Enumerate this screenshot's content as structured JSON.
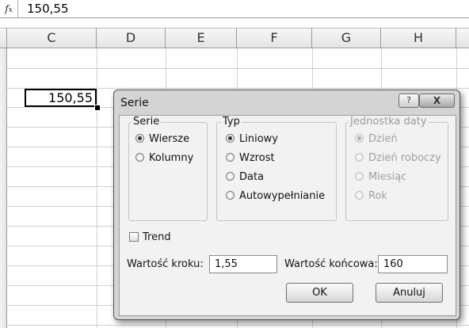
{
  "formula_bar": {
    "fx_icon": "fx-icon",
    "value": "150,55"
  },
  "columns": [
    "C",
    "D",
    "E",
    "F",
    "G",
    "H"
  ],
  "active_cell": {
    "value": "150,55"
  },
  "dialog": {
    "title": "Serie",
    "help_label": "?",
    "close_label": "X",
    "serie_group": {
      "title": "Serie",
      "options": [
        {
          "label": "Wiersze",
          "selected": true
        },
        {
          "label": "Kolumny",
          "selected": false
        }
      ]
    },
    "typ_group": {
      "title": "Typ",
      "options": [
        {
          "label": "Liniowy",
          "selected": true
        },
        {
          "label": "Wzrost",
          "selected": false
        },
        {
          "label": "Data",
          "selected": false
        },
        {
          "label": "Autowypełnianie",
          "selected": false
        }
      ]
    },
    "date_unit_group": {
      "title": "Jednostka daty",
      "options": [
        {
          "label": "Dzień",
          "selected": true
        },
        {
          "label": "Dzień roboczy",
          "selected": false
        },
        {
          "label": "Miesiąc",
          "selected": false
        },
        {
          "label": "Rok",
          "selected": false
        }
      ]
    },
    "trend_label": "Trend",
    "step_label": "Wartość kroku:",
    "step_value": "1,55",
    "stop_label": "Wartość końcowa:",
    "stop_value": "160",
    "ok_label": "OK",
    "cancel_label": "Anuluj"
  }
}
